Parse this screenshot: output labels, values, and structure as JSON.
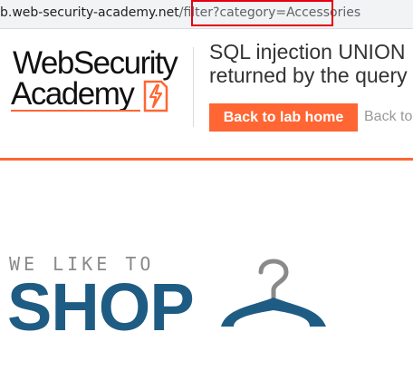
{
  "browser": {
    "url_host": "b.web-security-academy.net",
    "url_path": "/filter",
    "url_query": "?category=Accessories"
  },
  "header": {
    "logo_line1": "WebSecurity",
    "logo_line2": "Academy",
    "lab_title_line1": "SQL injection UNION",
    "lab_title_line2": "returned by the query",
    "back_button": "Back to lab home",
    "back_link": "Back to"
  },
  "hero": {
    "tagline": "WE LIKE TO",
    "shop": "SHOP"
  },
  "colors": {
    "brand_orange": "#ff6633",
    "shop_blue": "#1f5c84",
    "highlight_red": "#e60012"
  }
}
